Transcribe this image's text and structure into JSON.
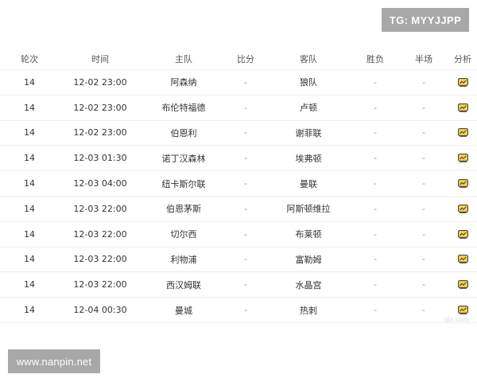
{
  "badges": {
    "tg": "TG: MYYJJPP",
    "site": "www.nanpin.net",
    "watermark_small": "qlx.com"
  },
  "table": {
    "headers": {
      "round": "轮次",
      "time": "时间",
      "home": "主队",
      "score": "比分",
      "away": "客队",
      "result": "胜负",
      "half": "半场",
      "analysis": "分析"
    },
    "rows": [
      {
        "round": "14",
        "time": "12-02 23:00",
        "home": "阿森纳",
        "score": "-",
        "away": "狼队",
        "result": "-",
        "half": "-"
      },
      {
        "round": "14",
        "time": "12-02 23:00",
        "home": "布伦特福德",
        "score": "-",
        "away": "卢顿",
        "result": "-",
        "half": "-"
      },
      {
        "round": "14",
        "time": "12-02 23:00",
        "home": "伯恩利",
        "score": "-",
        "away": "谢菲联",
        "result": "-",
        "half": "-"
      },
      {
        "round": "14",
        "time": "12-03 01:30",
        "home": "诺丁汉森林",
        "score": "-",
        "away": "埃弗顿",
        "result": "-",
        "half": "-"
      },
      {
        "round": "14",
        "time": "12-03 04:00",
        "home": "纽卡斯尔联",
        "score": "-",
        "away": "曼联",
        "result": "-",
        "half": "-"
      },
      {
        "round": "14",
        "time": "12-03 22:00",
        "home": "伯恩茅斯",
        "score": "-",
        "away": "阿斯顿维拉",
        "result": "-",
        "half": "-"
      },
      {
        "round": "14",
        "time": "12-03 22:00",
        "home": "切尔西",
        "score": "-",
        "away": "布莱顿",
        "result": "-",
        "half": "-"
      },
      {
        "round": "14",
        "time": "12-03 22:00",
        "home": "利物浦",
        "score": "-",
        "away": "富勒姆",
        "result": "-",
        "half": "-"
      },
      {
        "round": "14",
        "time": "12-03 22:00",
        "home": "西汉姆联",
        "score": "-",
        "away": "水晶宫",
        "result": "-",
        "half": "-"
      },
      {
        "round": "14",
        "time": "12-04 00:30",
        "home": "曼城",
        "score": "-",
        "away": "热刺",
        "result": "-",
        "half": "-"
      }
    ],
    "analysis_icon": "analysis-chart-icon",
    "colors": {
      "icon_fill": "#f2d64b",
      "icon_stroke": "#333333"
    }
  }
}
